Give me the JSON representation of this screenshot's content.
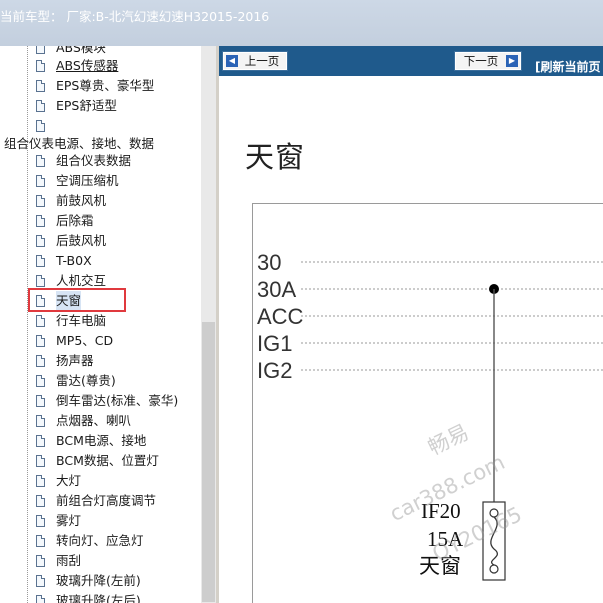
{
  "titlebar": {
    "text": "当前车型： 厂家:B-北汽幻速幻速H32015-2016"
  },
  "tree": {
    "items": [
      {
        "label": "ABS模块"
      },
      {
        "label": "ABS传感器"
      },
      {
        "label": "EPS尊贵、豪华型"
      },
      {
        "label": "EPS舒适型"
      },
      {
        "label": ""
      },
      {
        "label": "组合仪表数据"
      },
      {
        "label": "空调压缩机"
      },
      {
        "label": "前鼓风机"
      },
      {
        "label": "后除霜"
      },
      {
        "label": "后鼓风机"
      },
      {
        "label": "T-B0X"
      },
      {
        "label": "人机交互"
      },
      {
        "label": "天窗"
      },
      {
        "label": "行车电脑"
      },
      {
        "label": "MP5、CD"
      },
      {
        "label": "扬声器"
      },
      {
        "label": "雷达(尊贵)"
      },
      {
        "label": "倒车雷达(标准、豪华)"
      },
      {
        "label": "点烟器、喇叭"
      },
      {
        "label": "BCM电源、接地"
      },
      {
        "label": "BCM数据、位置灯"
      },
      {
        "label": "大灯"
      },
      {
        "label": "前组合灯高度调节"
      },
      {
        "label": "雾灯"
      },
      {
        "label": "转向灯、应急灯"
      },
      {
        "label": "雨刮"
      },
      {
        "label": "玻璃升降(左前)"
      },
      {
        "label": "玻璃升降(左后)"
      }
    ],
    "group_label": "组合仪表电源、接地、数据",
    "selected_index": 12
  },
  "nav": {
    "prev_label": "上一页",
    "next_label": "下一页",
    "refresh_label": "[刷新当前页"
  },
  "page": {
    "title": "天窗"
  },
  "diagram": {
    "rails": [
      "30",
      "30A",
      "ACC",
      "IG1",
      "IG2"
    ],
    "fuse_name": "IF20",
    "fuse_rating": "15A",
    "fuse_desc": "天窗"
  },
  "watermark": {
    "brand": "畅易",
    "site": "car388.com",
    "code": "QY20165"
  },
  "colors": {
    "nav_bg": "#1f5a8c",
    "highlight_border": "#e0393e",
    "titlebar_bg": "#c3cfde"
  }
}
